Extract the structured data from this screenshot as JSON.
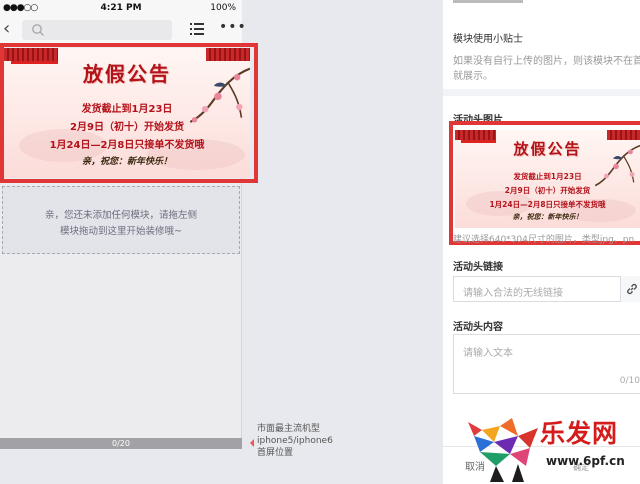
{
  "status_bar": {
    "carrier": "●●●○○",
    "time": "4:21 PM",
    "battery": "100%"
  },
  "nav": {
    "back_icon": "‹",
    "more_icon": "•••"
  },
  "banner": {
    "title": "放假公告",
    "line1": "发货截止到1月23日",
    "line2": "2月9日（初十）开始发货",
    "line3": "1月24日—2月8日只接单不发货哦",
    "greeting": "亲，祝您：新年快乐！"
  },
  "dropzone": {
    "line1": "亲，您还未添加任何模块，请拖左侧",
    "line2": "模块拖动到这里开始装修哦~"
  },
  "progress": {
    "label": "0/20",
    "value": 0,
    "max": 20
  },
  "device_hint": {
    "line1": "市面最主流机型",
    "line2": "iphone5/iphone6",
    "line3": "首屏位置"
  },
  "panel": {
    "tip_title": "模块使用小贴士",
    "tip_text1": "如果没有自行上传的图片，则该模块不在首",
    "tip_text2": "就展示。",
    "image_label": "活动头图片",
    "image_hint": "建议选择640*304尺寸的图片，类型jpg、pn",
    "link_label": "活动头链接",
    "link_placeholder": "请输入合法的无线链接",
    "content_label": "活动头内容",
    "content_placeholder": "请输入文本",
    "content_count": "0/10",
    "cancel_label": "取消",
    "save_label": "确定"
  },
  "watermark": {
    "brand": "乐发网",
    "url": "www.6pf.cn"
  },
  "colors": {
    "highlight_frame": "#e03636",
    "banner_red": "#b3121a",
    "panel_bg": "#ffffff",
    "canvas_bg": "#e8e9ee"
  }
}
